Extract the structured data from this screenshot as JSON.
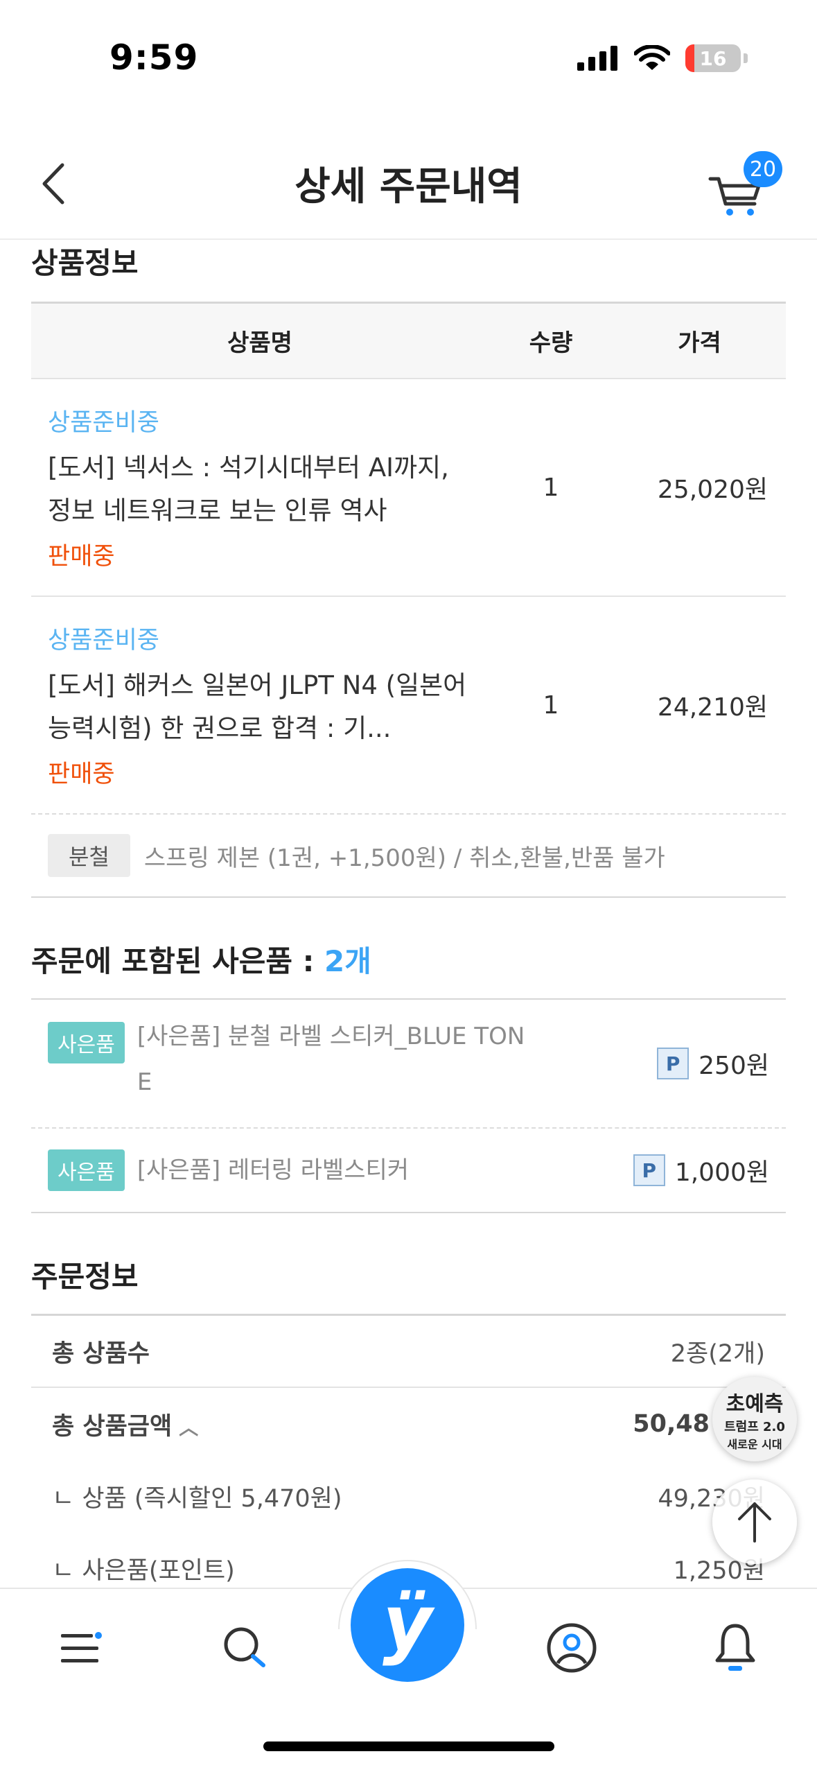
{
  "status_bar": {
    "time": "9:59",
    "battery_level": "16",
    "battery_fraction": 0.16
  },
  "header": {
    "title": "상세 주문내역",
    "cart_count": "20"
  },
  "product_section": {
    "title": "상품정보",
    "columns": {
      "name": "상품명",
      "qty": "수량",
      "price": "가격"
    },
    "items": [
      {
        "status": "상품준비중",
        "title": "[도서] 넥서스 : 석기시대부터 AI까지, 정보 네트워크로 보는 인류 역사",
        "sale_status": "판매중",
        "qty": "1",
        "price": "25,020원"
      },
      {
        "status": "상품준비중",
        "title": "[도서] 해커스 일본어 JLPT N4 (일본어능력시험) 한 권으로 합격 : 기...",
        "sale_status": "판매중",
        "qty": "1",
        "price": "24,210원"
      }
    ],
    "binding": {
      "tag": "분철",
      "text": "스프링 제본 (1권, +1,500원) / 취소,환불,반품 불가"
    }
  },
  "gift_section": {
    "title": "주문에 포함된 사은품 : ",
    "count": "2개",
    "items": [
      {
        "tag": "사은품",
        "name": "[사은품] 분철 라벨 스티커_BLUE TONE",
        "point_icon": "P",
        "price": "250원"
      },
      {
        "tag": "사은품",
        "name": "[사은품] 레터링 라벨스티커",
        "point_icon": "P",
        "price": "1,000원"
      }
    ]
  },
  "order_section": {
    "title": "주문정보",
    "rows": {
      "total_count_label": "총 상품수",
      "total_count_value": "2종(2개)",
      "total_amount_label": "총 상품금액",
      "total_amount_value": "50,48",
      "product_label": "ㄴ 상품 (즉시할인 5,470원)",
      "product_value": "49,230원",
      "gift_label": "ㄴ 사은품(포인트)",
      "gift_value": "1,250원"
    }
  },
  "promo": {
    "line1": "초예측",
    "line2": "트럼프 2.0",
    "line3": "새로운 시대"
  },
  "tab_bar": {
    "home_logo": "ÿ"
  },
  "colors": {
    "brand": "#1a8cff",
    "accent_blue": "#3ba4f5",
    "sale_orange": "#f0500a",
    "gift_teal": "#6dccc9"
  }
}
